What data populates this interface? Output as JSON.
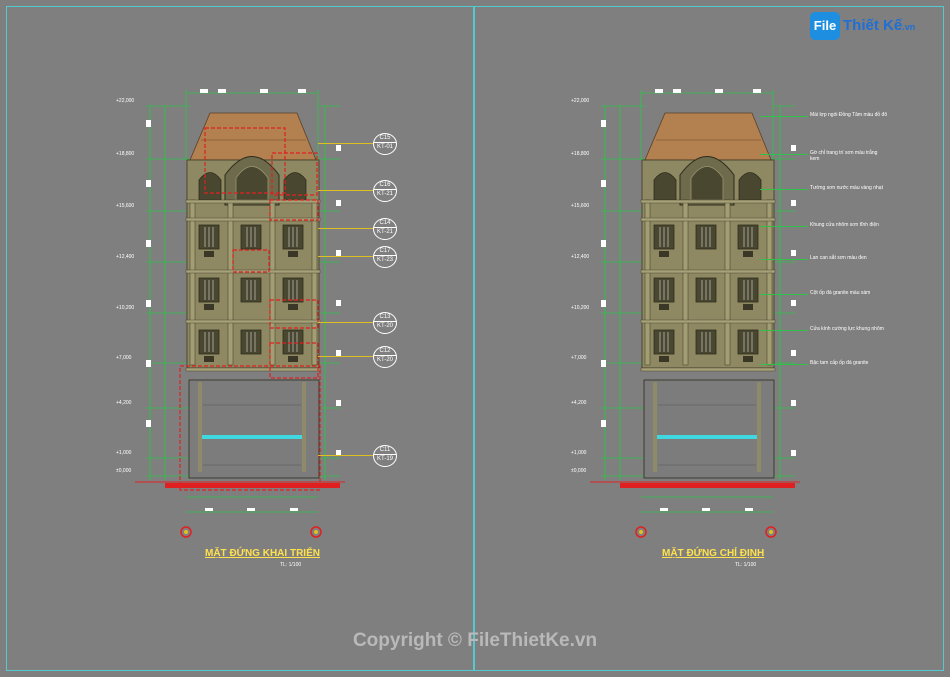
{
  "logo": {
    "icon_text": "File",
    "brand": "Thiết Kế",
    "domain": ".vn"
  },
  "watermark": "Copyright © FileThietKe.vn",
  "sheets": [
    {
      "title": "MẶT ĐỨNG KHAI TRIỂN",
      "scale": "TL: 1/100",
      "levels": [
        "+22,000",
        "+18,800",
        "+15,600",
        "+12,400",
        "+10,200",
        "+7,000",
        "+4,200",
        "+1,000",
        "±0,000"
      ],
      "tags": [
        {
          "code": "C15",
          "sub": "KT-01"
        },
        {
          "code": "C16",
          "sub": "KT-21"
        },
        {
          "code": "C14",
          "sub": "KT-21"
        },
        {
          "code": "C17",
          "sub": "KT-23"
        },
        {
          "code": "C13",
          "sub": "KT-20"
        },
        {
          "code": "C12",
          "sub": "KT-20"
        },
        {
          "code": "C11",
          "sub": "KT-19"
        }
      ]
    },
    {
      "title": "MẶT ĐỨNG CHỈ ĐỊNH",
      "scale": "TL: 1/100",
      "levels": [
        "+22,000",
        "+18,800",
        "+15,600",
        "+12,400",
        "+10,200",
        "+7,000",
        "+4,200",
        "+1,000",
        "±0,000"
      ],
      "notes": [
        "Mái lợp ngói Đồng Tâm màu đỏ đô",
        "Gờ chỉ trang trí sơn màu trắng kem",
        "Tường sơn nước màu vàng nhạt",
        "Khung cửa nhôm sơn tĩnh điện",
        "Lan can sắt sơn màu đen",
        "Cột ốp đá granite màu xám",
        "Cửa kính cường lực khung nhôm",
        "Bậc tam cấp ốp đá granite"
      ]
    }
  ],
  "colors": {
    "background": "#7f7f7f",
    "border": "#55c8d0",
    "dim": "#2fc24a",
    "tag": "#ffffff",
    "redline": "#e02020",
    "roof": "#b38050",
    "wall": "#8f8963",
    "glass": "#3fd8e0"
  }
}
